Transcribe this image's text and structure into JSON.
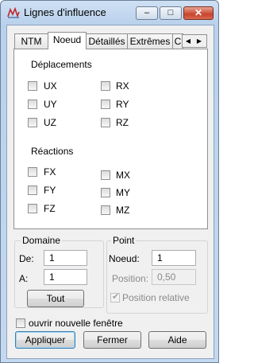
{
  "window": {
    "title": "Lignes d'influence",
    "min_glyph": "–",
    "max_glyph": "□",
    "close_glyph": "✕"
  },
  "tabs": [
    {
      "label": "NTM",
      "active": false
    },
    {
      "label": "Noeud",
      "active": true
    },
    {
      "label": "Détaillés",
      "active": false
    },
    {
      "label": "Extrêmes",
      "active": false
    },
    {
      "label": "C",
      "active": false
    }
  ],
  "tab_scroll": {
    "left": "◀",
    "right": "▶"
  },
  "deplacements": {
    "heading": "Déplacements",
    "items": [
      {
        "label": "UX",
        "checked": false
      },
      {
        "label": "UY",
        "checked": false
      },
      {
        "label": "UZ",
        "checked": false
      },
      {
        "label": "RX",
        "checked": false
      },
      {
        "label": "RY",
        "checked": false
      },
      {
        "label": "RZ",
        "checked": false
      }
    ]
  },
  "reactions": {
    "heading": "Réactions",
    "items": [
      {
        "label": "FX",
        "checked": false
      },
      {
        "label": "FY",
        "checked": false
      },
      {
        "label": "FZ",
        "checked": false
      },
      {
        "label": "MX",
        "checked": false
      },
      {
        "label": "MY",
        "checked": false
      },
      {
        "label": "MZ",
        "checked": false
      }
    ]
  },
  "domaine": {
    "title": "Domaine",
    "de_label": "De:",
    "de_value": "1",
    "a_label": "A:",
    "a_value": "1",
    "tout_label": "Tout"
  },
  "point": {
    "title": "Point",
    "noeud_label": "Noeud:",
    "noeud_value": "1",
    "position_label": "Position:",
    "position_value": "0,50",
    "relative_label": "Position relative",
    "relative_checked": true,
    "relative_disabled": true
  },
  "new_window": {
    "label": "ouvrir nouvelle fenêtre",
    "checked": false
  },
  "buttons": {
    "apply": "Appliquer",
    "close": "Fermer",
    "help": "Aide"
  }
}
